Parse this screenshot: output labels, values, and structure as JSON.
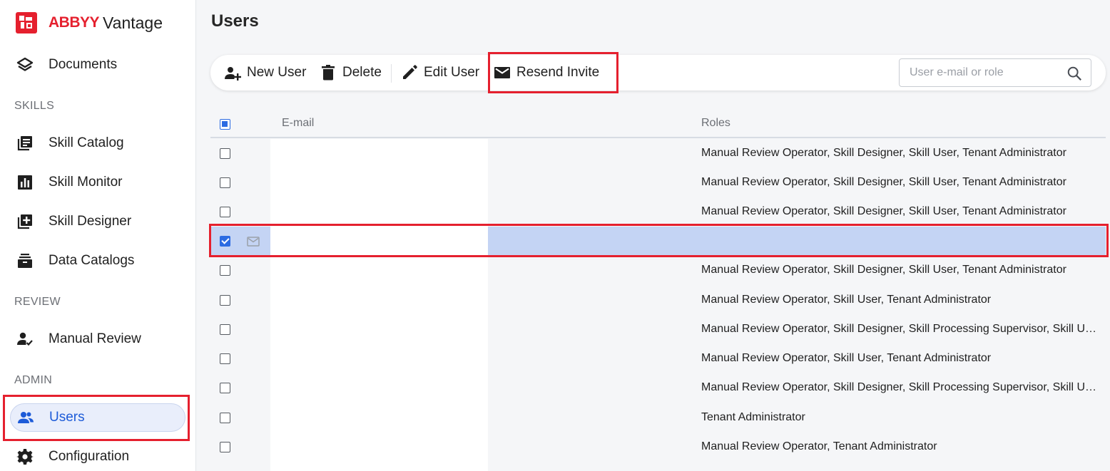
{
  "app": {
    "brand": "ABBYY",
    "product": "Vantage"
  },
  "sidebar": {
    "items": [
      {
        "label": "Documents",
        "icon": "layers-icon"
      },
      {
        "label": "Skill Catalog",
        "icon": "catalog-icon"
      },
      {
        "label": "Skill Monitor",
        "icon": "bar-chart-icon"
      },
      {
        "label": "Skill Designer",
        "icon": "add-box-icon"
      },
      {
        "label": "Data Catalogs",
        "icon": "archive-icon"
      },
      {
        "label": "Manual Review",
        "icon": "person-check-icon"
      },
      {
        "label": "Users",
        "icon": "users-icon",
        "active": true
      },
      {
        "label": "Configuration",
        "icon": "gear-icon"
      }
    ],
    "sections": {
      "skills": "SKILLS",
      "review": "REVIEW",
      "admin": "ADMIN"
    }
  },
  "main": {
    "title": "Users",
    "toolbar": {
      "new_user": "New User",
      "delete": "Delete",
      "edit_user": "Edit User",
      "resend_invite": "Resend Invite",
      "search_placeholder": "User e-mail or role"
    },
    "table": {
      "columns": {
        "email": "E-mail",
        "roles": "Roles"
      },
      "rows": [
        {
          "roles": "Manual Review Operator, Skill Designer, Skill User, Tenant Administrator",
          "checked": false
        },
        {
          "roles": "Manual Review Operator, Skill Designer, Skill User, Tenant Administrator",
          "checked": false
        },
        {
          "roles": "Manual Review Operator, Skill Designer, Skill User, Tenant Administrator",
          "checked": false
        },
        {
          "roles": "",
          "checked": true,
          "invite_pending": true
        },
        {
          "roles": "Manual Review Operator, Skill Designer, Skill User, Tenant Administrator",
          "checked": false
        },
        {
          "roles": "Manual Review Operator, Skill User, Tenant Administrator",
          "checked": false
        },
        {
          "roles": "Manual Review Operator, Skill Designer, Skill Processing Supervisor, Skill User, Tenant Administrator",
          "checked": false
        },
        {
          "roles": "Manual Review Operator, Skill User, Tenant Administrator",
          "checked": false
        },
        {
          "roles": "Manual Review Operator, Skill Designer, Skill Processing Supervisor, Skill User, Tenant Administrator",
          "checked": false
        },
        {
          "roles": "Tenant Administrator",
          "checked": false
        },
        {
          "roles": "Manual Review Operator, Tenant Administrator",
          "checked": false
        }
      ]
    }
  },
  "colors": {
    "accent": "#1d5bd8",
    "brand": "#e5202e",
    "selection": "#c4d4f4",
    "highlight": "#e5202e"
  }
}
